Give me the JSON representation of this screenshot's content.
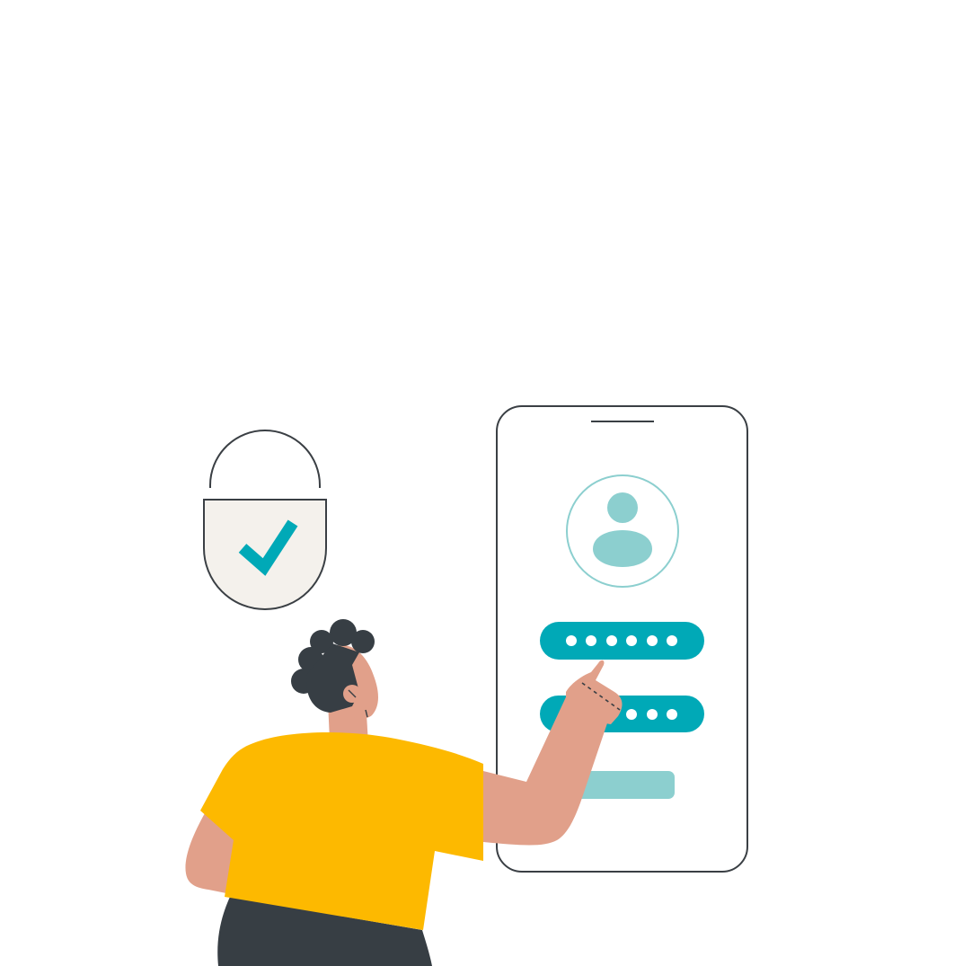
{
  "illustration": {
    "colors": {
      "teal": "#00a9b7",
      "teal_light": "#8ccfcf",
      "outline": "#3a3f44",
      "lock_fill": "#f4f1ec",
      "skin": "#e1a08a",
      "shirt": "#fdb900",
      "hair": "#373e44",
      "pants": "#373e44",
      "background": "#ffffff"
    },
    "lock": {
      "icon": "padlock-with-checkmark-icon"
    },
    "phone": {
      "avatar_icon": "user-avatar-icon",
      "password_field_1_mask": "••••••",
      "password_field_2_mask": "••••••",
      "submit_button_label": ""
    },
    "person": {
      "description": "person-pointing-at-phone"
    }
  }
}
